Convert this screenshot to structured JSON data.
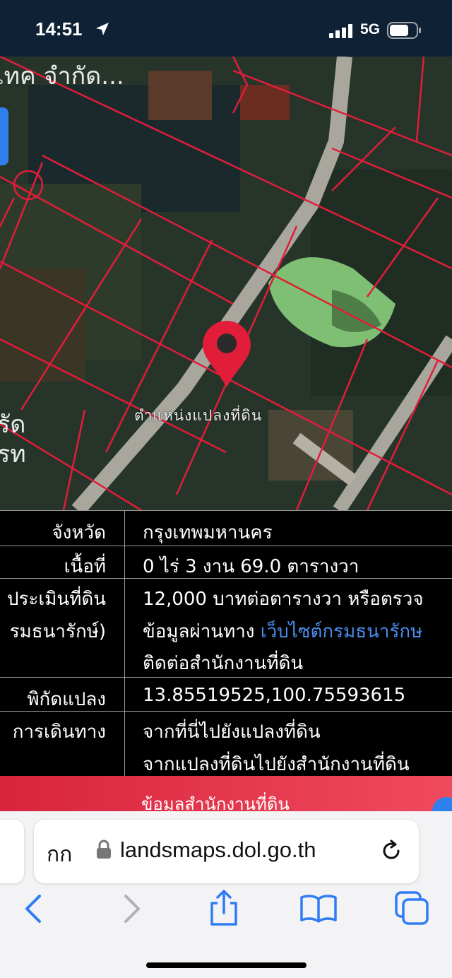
{
  "status_bar": {
    "time": "14:51",
    "network": "5G"
  },
  "map": {
    "label_top_left": "เทค จำกัด...",
    "label_left_line1": "รัด",
    "label_left_line2": "รท",
    "pin_label": "ตำแหน่งแปลงที่ดิน",
    "icons": [
      "location-pin-icon"
    ],
    "accent_color": "#e11d3a"
  },
  "info": {
    "province_label": "จังหวัด",
    "province_value": "กรุงเทพมหานคร",
    "area_label": "เนื้อที่",
    "area_value": "0 ไร่ 3 งาน 69.0 ตารางวา",
    "price_label_line1": "ประเมินที่ดิน",
    "price_label_line2": "รมธนารักษ์)",
    "price_value_line1": "12,000 บาทต่อตารางวา หรือตรวจ",
    "price_value_line2_prefix": "ข้อมูลผ่านทาง ",
    "price_value_line2_link": "เว็บไซต์กรมธนารักษ",
    "price_value_line3": "ติดต่อสำนักงานที่ดิน",
    "coords_label": "พิกัดแปลง",
    "coords_value": "13.85519525,100.75593615",
    "route_label": "การเดินทาง",
    "route_link1": "จากที่นี่ไปยังแปลงที่ดิน",
    "route_link2": "จากแปลงที่ดินไปยังสำนักงานที่ดิน"
  },
  "red_bar": {
    "label": "ข้อมูลสำนักงานที่ดิน",
    "color": "#e0283f"
  },
  "browser": {
    "text_size_button": "กก",
    "url": "landsmaps.dol.go.th",
    "icons": [
      "lock-icon",
      "reload-icon",
      "back-icon",
      "forward-icon",
      "share-icon",
      "bookmarks-icon",
      "tabs-icon"
    ],
    "accent_color": "#2f7cf6"
  }
}
